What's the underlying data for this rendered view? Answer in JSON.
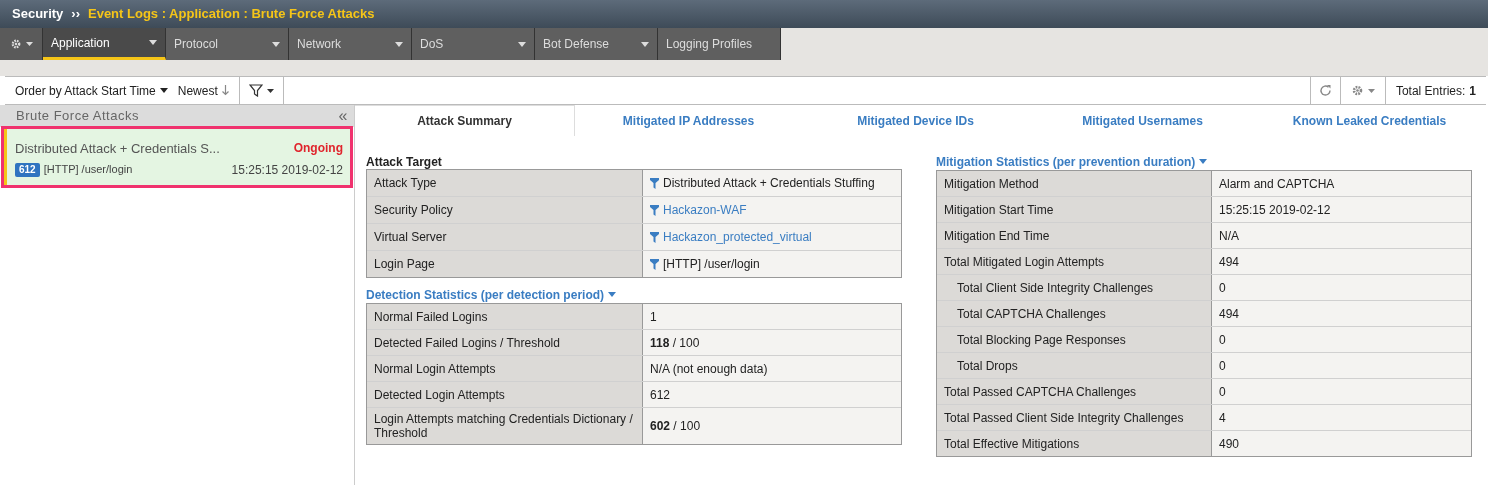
{
  "breadcrumb": {
    "root": "Security",
    "separator": "››",
    "path": "Event Logs : Application : Brute Force Attacks"
  },
  "nav_tabs": [
    {
      "label": "Application",
      "selected": true,
      "dropdown": true
    },
    {
      "label": "Protocol",
      "selected": false,
      "dropdown": true
    },
    {
      "label": "Network",
      "selected": false,
      "dropdown": true
    },
    {
      "label": "DoS",
      "selected": false,
      "dropdown": true
    },
    {
      "label": "Bot Defense",
      "selected": false,
      "dropdown": true
    },
    {
      "label": "Logging Profiles",
      "selected": false,
      "dropdown": false
    }
  ],
  "toolbar": {
    "order_by": "Order by Attack Start Time",
    "sort": "Newest",
    "total_label": "Total Entries:",
    "total": "1"
  },
  "attacks_panel": {
    "title": "Brute Force Attacks",
    "collapse": "«",
    "items": [
      {
        "name": "Distributed Attack + Credentials S...",
        "status": "Ongoing",
        "count": "612",
        "page": "[HTTP] /user/login",
        "time": "15:25:15 2019-02-12",
        "selected": true
      }
    ]
  },
  "detail_tabs": [
    {
      "label": "Attack Summary",
      "selected": true
    },
    {
      "label": "Mitigated IP Addresses",
      "selected": false
    },
    {
      "label": "Mitigated Device IDs",
      "selected": false
    },
    {
      "label": "Mitigated Usernames",
      "selected": false
    },
    {
      "label": "Known Leaked Credentials",
      "selected": false
    }
  ],
  "attack_target": {
    "title": "Attack Target",
    "rows": [
      {
        "label": "Attack Type",
        "value": "Distributed Attack + Credentials Stuffing",
        "filter": true,
        "link": false
      },
      {
        "label": "Security Policy",
        "value": "Hackazon-WAF",
        "filter": true,
        "link": true
      },
      {
        "label": "Virtual Server",
        "value": "Hackazon_protected_virtual",
        "filter": true,
        "link": true
      },
      {
        "label": "Login Page",
        "value": "[HTTP] /user/login",
        "filter": true,
        "link": false
      }
    ]
  },
  "detection_statistics": {
    "title": "Detection Statistics (per detection period)",
    "rows": [
      {
        "label": "Normal Failed Logins",
        "value": "1"
      },
      {
        "label": "Detected Failed Logins / Threshold",
        "value": "**118** / 100"
      },
      {
        "label": "Normal Login Attempts",
        "value": "N/A (not enough data)"
      },
      {
        "label": "Detected Login Attempts",
        "value": "612"
      },
      {
        "label": "Login Attempts matching Credentials Dictionary / Threshold",
        "value": "**602** / 100"
      }
    ]
  },
  "mitigation_statistics": {
    "title": "Mitigation Statistics (per prevention duration)",
    "rows": [
      {
        "label": "Mitigation Method",
        "value": "Alarm and CAPTCHA"
      },
      {
        "label": "Mitigation Start Time",
        "value": "15:25:15 2019-02-12"
      },
      {
        "label": "Mitigation End Time",
        "value": "N/A"
      },
      {
        "label": "Total Mitigated Login Attempts",
        "value": "494",
        "children": [
          {
            "label": "Total Client Side Integrity Challenges",
            "value": "0"
          },
          {
            "label": "Total CAPTCHA Challenges",
            "value": "494"
          },
          {
            "label": "Total Blocking Page Responses",
            "value": "0"
          },
          {
            "label": "Total Drops",
            "value": "0"
          }
        ]
      },
      {
        "label": "Total Passed CAPTCHA Challenges",
        "value": "0"
      },
      {
        "label": "Total Passed Client Side Integrity Challenges",
        "value": "4"
      },
      {
        "label": "Total Effective Mitigations",
        "value": "490"
      }
    ]
  }
}
